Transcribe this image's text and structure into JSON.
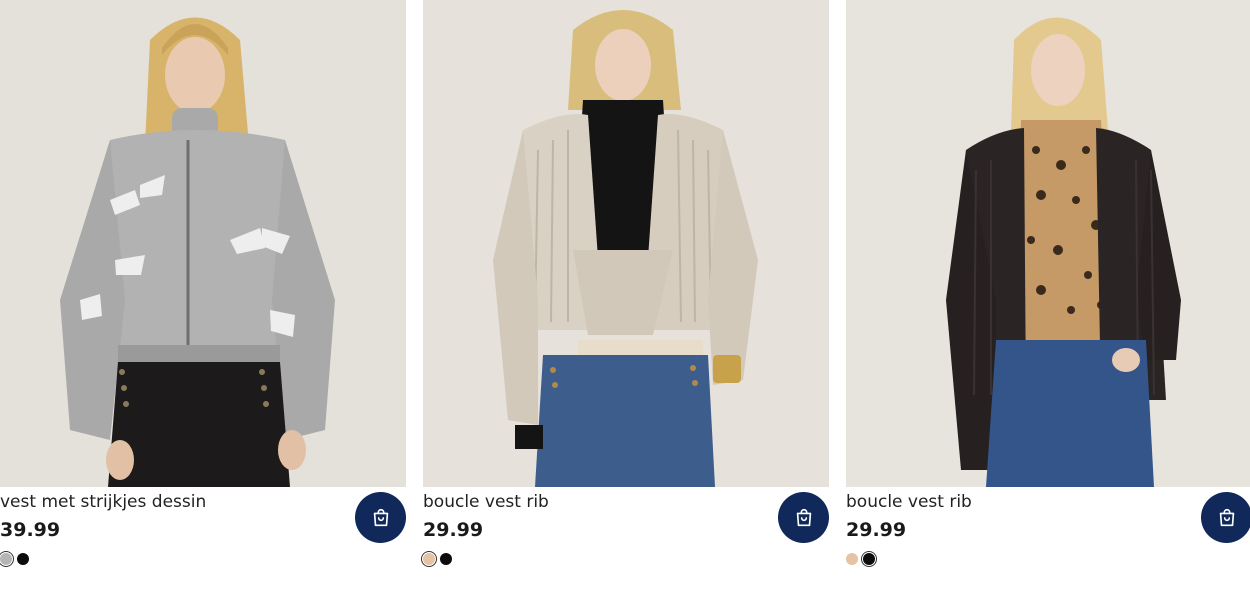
{
  "products": [
    {
      "title": "vest met strijkjes dessin",
      "price": "39.99",
      "image_label": "grey knit zip cardigan with bow pattern",
      "swatches": [
        {
          "color": "#b5b5b5",
          "selected": true
        },
        {
          "color": "#0c0c0c",
          "selected": false
        }
      ]
    },
    {
      "title": "boucle vest rib",
      "price": "29.99",
      "image_label": "beige ribbed boucle cardigan",
      "swatches": [
        {
          "color": "#e6c3a2",
          "selected": true
        },
        {
          "color": "#0c0c0c",
          "selected": false
        }
      ]
    },
    {
      "title": "boucle vest rib",
      "price": "29.99",
      "image_label": "black ribbed boucle cardigan",
      "swatches": [
        {
          "color": "#e6c3a2",
          "selected": false
        },
        {
          "color": "#0c0c0c",
          "selected": true
        }
      ]
    }
  ],
  "colors": {
    "cart_button_bg": "#10285a",
    "cart_icon": "#ffffff"
  },
  "icons": {
    "cart": "shopping-bag-icon"
  }
}
